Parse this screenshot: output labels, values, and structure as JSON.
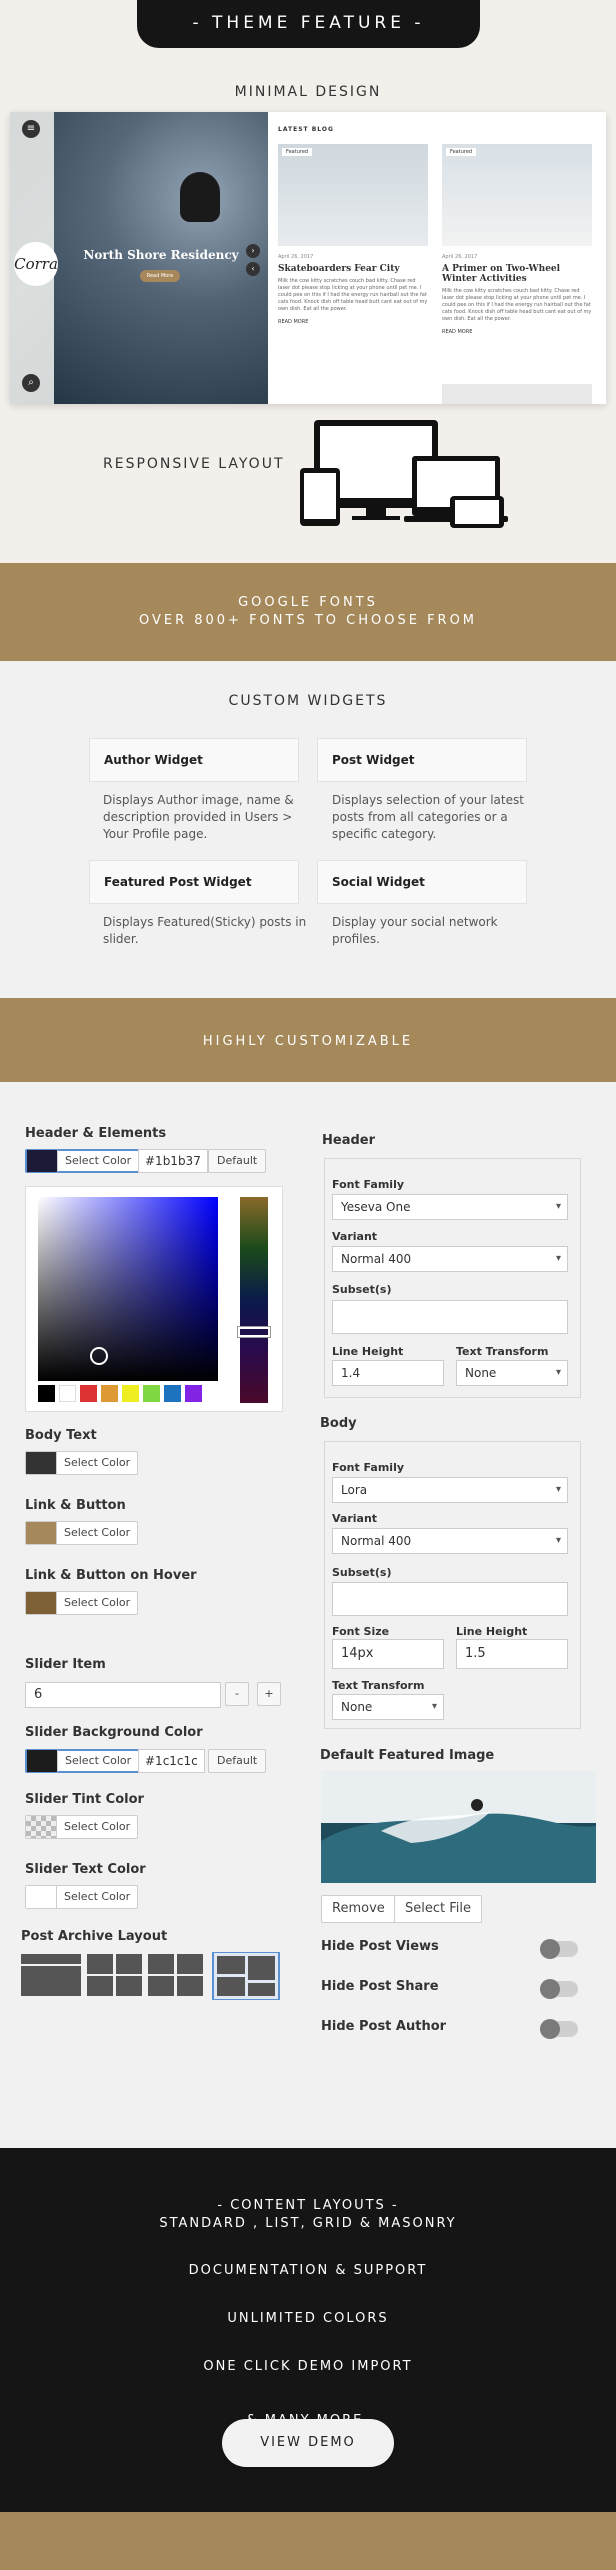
{
  "header": {
    "title": "- THEME FEATURE -"
  },
  "minimal": {
    "label": "MINIMAL DESIGN"
  },
  "demo": {
    "slider_title": "North Shore Residency",
    "slider_button": "Read More",
    "logo": "Corra",
    "latest": "LATEST BLOG",
    "cards": [
      {
        "tag": "Featured",
        "date": "April 26, 2017",
        "title": "Skateboarders Fear City",
        "excerpt": "Milk the cow kitty scratches couch bad kitty. Chase red laser dot please stop licking at your phone until pet me. I could pee on this if I had the energy run hairball out the fat cats food. Knock dish off table head butt cant eat out of my own dish. Eat all the power.",
        "more": "READ MORE"
      },
      {
        "tag": "Featured",
        "date": "April 26, 2017",
        "title": "A Primer on Two-Wheel Winter Activities",
        "excerpt": "Milk the cow kitty scratches couch bad kitty. Chase red laser dot please stop licking at your phone until pet me. I could pee on this if I had the energy run hairball out the fat cats food. Knock dish off table head butt cant eat out of my own dish. Eat all the power.",
        "more": "READ MORE"
      }
    ]
  },
  "responsive": {
    "label": "RESPONSIVE LAYOUT"
  },
  "fonts": {
    "line1": "GOOGLE FONTS",
    "line2": "OVER 800+ FONTS TO CHOOSE FROM"
  },
  "widgets": {
    "title": "CUSTOM WIDGETS",
    "items": [
      {
        "name": "Author Widget",
        "desc": "Displays Author image, name & description provided in Users > Your Profile page."
      },
      {
        "name": "Post Widget",
        "desc": "Displays selection of your latest posts from all categories or a specific category."
      },
      {
        "name": "Featured Post Widget",
        "desc": "Displays Featured(Sticky) posts in slider."
      },
      {
        "name": "Social Widget",
        "desc": "Display your social network profiles."
      }
    ]
  },
  "customizable": {
    "title": "HIGHLY CUSTOMIZABLE"
  },
  "colors": {
    "header_label": "Header & Elements",
    "header_color": "#1b1b37",
    "select_color": "Select Color",
    "default": "Default",
    "palette": [
      "#000000",
      "#ffffff",
      "#dd3333",
      "#dd9933",
      "#eeee22",
      "#81d742",
      "#1e73be",
      "#8224e3"
    ],
    "body_label": "Body Text",
    "body_color": "#333333",
    "link_label": "Link & Button",
    "link_color": "#a6895b",
    "hover_label": "Link & Button on Hover",
    "hover_color": "#7d6035",
    "slider_item_label": "Slider Item",
    "slider_item_value": "6",
    "minus": "-",
    "plus": "+",
    "slider_bg_label": "Slider Background Color",
    "slider_bg_color": "#1c1c1c",
    "tint_label": "Slider Tint Color",
    "text_label": "Slider Text Color",
    "text_color": "#ffffff",
    "archive_label": "Post Archive Layout"
  },
  "typo": {
    "header_title": "Header",
    "font_family_label": "Font Family",
    "header_font": "Yeseva One",
    "variant_label": "Variant",
    "header_variant": "Normal 400",
    "subset_label": "Subset(s)",
    "line_height_label": "Line Height",
    "header_line_height": "1.4",
    "transform_label": "Text Transform",
    "header_transform": "None",
    "body_title": "Body",
    "body_font": "Lora",
    "body_variant": "Normal 400",
    "font_size_label": "Font Size",
    "body_font_size": "14px",
    "body_line_height": "1.5",
    "body_transform": "None"
  },
  "featured": {
    "title": "Default Featured Image",
    "remove": "Remove",
    "select": "Select File"
  },
  "toggles": [
    "Hide Post Views",
    "Hide Post Share",
    "Hide Post Author"
  ],
  "dark": {
    "line1": "- CONTENT LAYOUTS -",
    "line2": "STANDARD , LIST, GRID & MASONRY",
    "line3": "DOCUMENTATION & SUPPORT",
    "line4": "UNLIMITED COLORS",
    "line5": "ONE CLICK DEMO IMPORT",
    "line6": "& MANY MORE."
  },
  "cta": {
    "label": "VIEW DEMO"
  }
}
